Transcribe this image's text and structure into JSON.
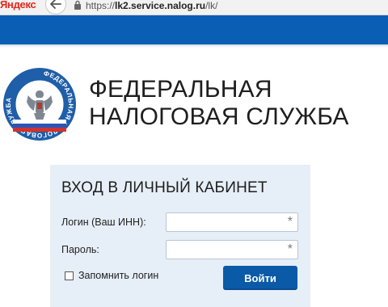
{
  "browser": {
    "brand": "Яндекс",
    "url_prefix": "https://",
    "url_host": "lk2.service.nalog.ru",
    "url_path": "/lk/"
  },
  "org": {
    "title_line1": "ФЕДЕРАЛЬНАЯ",
    "title_line2": "НАЛОГОВАЯ СЛУЖБА",
    "logo_text": "ФЕДЕРАЛЬНАЯ НАЛОГОВАЯ СЛУЖБА"
  },
  "login": {
    "title": "ВХОД В ЛИЧНЫЙ КАБИНЕТ",
    "login_label": "Логин (Ваш ИНН):",
    "password_label": "Пароль:",
    "login_value": "",
    "password_value": "",
    "required_mark": "*",
    "remember_label": "Запомнить логин",
    "remember_checked": false,
    "submit_label": "Войти"
  },
  "colors": {
    "header_band": "#0a5fb4",
    "panel_bg": "#e6eef7",
    "button_bg": "#0b5aa8"
  }
}
